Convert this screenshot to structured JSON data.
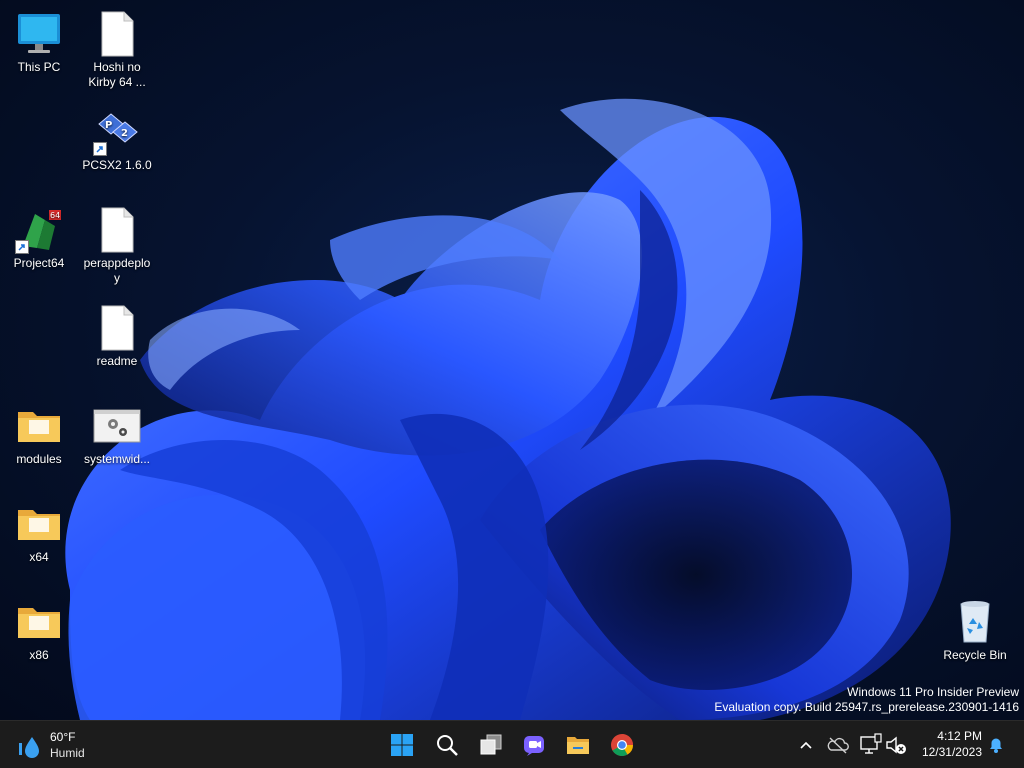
{
  "desktop": {
    "icons": [
      {
        "label": "This PC",
        "icon": "computer-monitor-icon"
      },
      {
        "label": "Hoshi no Kirby 64 ...",
        "icon": "blank-file-icon"
      },
      {
        "label": "PCSX2 1.6.0",
        "icon": "pcsx2-logo-icon"
      },
      {
        "label": "Project64",
        "icon": "project64-logo-icon"
      },
      {
        "label": "perappdeploy",
        "icon": "blank-file-icon"
      },
      {
        "label": "readme",
        "icon": "blank-file-icon"
      },
      {
        "label": "modules",
        "icon": "folder-icon"
      },
      {
        "label": "systemwid...",
        "icon": "settings-file-icon"
      },
      {
        "label": "x64",
        "icon": "folder-icon"
      },
      {
        "label": "x86",
        "icon": "folder-icon"
      },
      {
        "label": "Recycle Bin",
        "icon": "recycle-bin-icon"
      }
    ],
    "watermark": {
      "line1": "Windows 11 Pro Insider Preview",
      "line2": "Evaluation copy. Build 25947.rs_prerelease.230901-1416"
    },
    "wallpaper_colors": {
      "primary": "#1f4bff",
      "highlight": "#4f7dff",
      "shadow": "#0a1a6e",
      "background": "#061330"
    }
  },
  "taskbar": {
    "background": "#1c1c1c",
    "weather": {
      "temperature": "60°F",
      "condition": "Humid",
      "icon": "raindrop-icon"
    },
    "pinned": [
      {
        "name": "Start",
        "icon": "windows-start-icon"
      },
      {
        "name": "Search",
        "icon": "search-icon"
      },
      {
        "name": "Task View",
        "icon": "task-view-icon"
      },
      {
        "name": "Chat",
        "icon": "teams-chat-icon"
      },
      {
        "name": "File Explorer",
        "icon": "file-explorer-icon"
      },
      {
        "name": "Google Chrome",
        "icon": "chrome-icon"
      }
    ],
    "tray": {
      "time": "4:12 PM",
      "date": "12/31/2023",
      "icons": [
        "chevron-up-icon",
        "onedrive-icon",
        "network-icon",
        "volume-muted-icon",
        "notification-bell-icon"
      ]
    }
  }
}
